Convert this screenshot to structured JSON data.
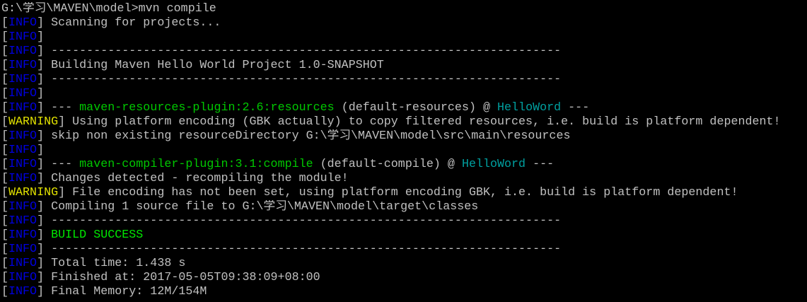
{
  "window": {
    "type": "command-prompt",
    "background": "#000000"
  },
  "colors": {
    "text": "#c0c0c0",
    "info": "#0000e0",
    "warning": "#e0e000",
    "plugin": "#00c800",
    "project": "#00a0a0",
    "success": "#00e800"
  },
  "lines": [
    {
      "segments": [
        {
          "t": "G:\\学习\\MAVEN\\model>mvn compile",
          "c": "text"
        }
      ]
    },
    {
      "level": "INFO",
      "segments": [
        {
          "t": " Scanning for projects...",
          "c": "text"
        }
      ]
    },
    {
      "level": "INFO",
      "segments": []
    },
    {
      "level": "INFO",
      "segments": [
        {
          "t": " ------------------------------------------------------------------------",
          "c": "text"
        }
      ]
    },
    {
      "level": "INFO",
      "segments": [
        {
          "t": " Building Maven Hello World Project 1.0-SNAPSHOT",
          "c": "text"
        }
      ]
    },
    {
      "level": "INFO",
      "segments": [
        {
          "t": " ------------------------------------------------------------------------",
          "c": "text"
        }
      ]
    },
    {
      "level": "INFO",
      "segments": []
    },
    {
      "level": "INFO",
      "segments": [
        {
          "t": " --- ",
          "c": "text"
        },
        {
          "t": "maven-resources-plugin:2.6:resources",
          "c": "plugin"
        },
        {
          "t": " (default-resources) @ ",
          "c": "text"
        },
        {
          "t": "HelloWord",
          "c": "project"
        },
        {
          "t": " ---",
          "c": "text"
        }
      ]
    },
    {
      "level": "WARNING",
      "segments": [
        {
          "t": " Using platform encoding (GBK actually) to copy filtered resources, i.e. build is platform dependent!",
          "c": "text"
        }
      ]
    },
    {
      "level": "INFO",
      "segments": [
        {
          "t": " skip non existing resourceDirectory G:\\学习\\MAVEN\\model\\src\\main\\resources",
          "c": "text"
        }
      ]
    },
    {
      "level": "INFO",
      "segments": []
    },
    {
      "level": "INFO",
      "segments": [
        {
          "t": " --- ",
          "c": "text"
        },
        {
          "t": "maven-compiler-plugin:3.1:compile",
          "c": "plugin"
        },
        {
          "t": " (default-compile) @ ",
          "c": "text"
        },
        {
          "t": "HelloWord",
          "c": "project"
        },
        {
          "t": " ---",
          "c": "text"
        }
      ]
    },
    {
      "level": "INFO",
      "segments": [
        {
          "t": " Changes detected - recompiling the module!",
          "c": "text"
        }
      ]
    },
    {
      "level": "WARNING",
      "segments": [
        {
          "t": " File encoding has not been set, using platform encoding GBK, i.e. build is platform dependent!",
          "c": "text"
        }
      ]
    },
    {
      "level": "INFO",
      "segments": [
        {
          "t": " Compiling 1 source file to G:\\学习\\MAVEN\\model\\target\\classes",
          "c": "text"
        }
      ]
    },
    {
      "level": "INFO",
      "segments": [
        {
          "t": " ------------------------------------------------------------------------",
          "c": "text"
        }
      ]
    },
    {
      "level": "INFO",
      "segments": [
        {
          "t": " BUILD SUCCESS",
          "c": "success"
        }
      ]
    },
    {
      "level": "INFO",
      "segments": [
        {
          "t": " ------------------------------------------------------------------------",
          "c": "text"
        }
      ]
    },
    {
      "level": "INFO",
      "segments": [
        {
          "t": " Total time: 1.438 s",
          "c": "text"
        }
      ]
    },
    {
      "level": "INFO",
      "segments": [
        {
          "t": " Finished at: 2017-05-05T09:38:09+08:00",
          "c": "text"
        }
      ]
    },
    {
      "level": "INFO",
      "segments": [
        {
          "t": " Final Memory: 12M/154M",
          "c": "text"
        }
      ]
    }
  ]
}
